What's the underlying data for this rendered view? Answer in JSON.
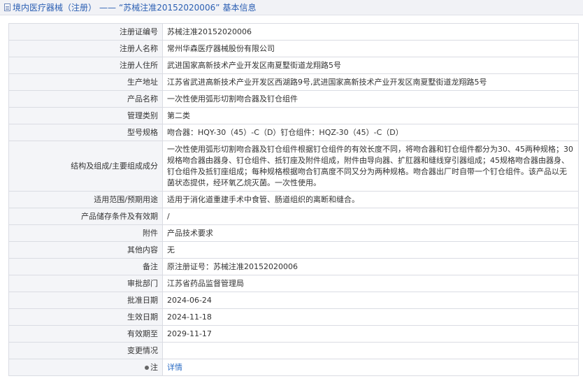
{
  "header": {
    "prefix": "境内医疗器械（注册）",
    "dash": "——",
    "reg_no_quoted": "“苏械注准20152020006”",
    "suffix": "基本信息"
  },
  "rows": [
    {
      "label": "注册证编号",
      "value": "苏械注准20152020006"
    },
    {
      "label": "注册人名称",
      "value": "常州华森医疗器械股份有限公司"
    },
    {
      "label": "注册人住所",
      "value": "武进国家高新技术产业开发区南夏墅街道龙翔路5号"
    },
    {
      "label": "生产地址",
      "value": "江苏省武进高新技术产业开发区西湖路9号,武进国家高新技术产业开发区南夏墅街道龙翔路5号"
    },
    {
      "label": "产品名称",
      "value": "一次性使用弧形切割吻合器及钉仓组件"
    },
    {
      "label": "管理类别",
      "value": "第二类"
    },
    {
      "label": "型号规格",
      "value": "吻合器：HQY-30（45）-C（D）钉仓组件：HQZ-30（45）-C（D）"
    },
    {
      "label": "结构及组成/主要组成成分",
      "value": "一次性使用弧形切割吻合器及钉仓组件根据钉仓组件的有效长度不同，将吻合器和钉仓组件都分为30、45两种规格；30规格吻合器由器身、钉仓组件、抵钉座及附件组成，附件由导向器、扩肛器和缝线穿引器组成；45规格吻合器由器身、钉仓组件及抵钉座组成；每种规格根据吻合钉高度不同又分为两种规格。吻合器出厂时自带一个钉仓组件。该产品以无菌状态提供，经环氧乙烷灭菌。一次性使用。"
    },
    {
      "label": "适用范围/预期用途",
      "value": "适用于消化道重建手术中食管、肠道组织的离断和缝合。"
    },
    {
      "label": "产品储存条件及有效期",
      "value": "/"
    },
    {
      "label": "附件",
      "value": "产品技术要求"
    },
    {
      "label": "其他内容",
      "value": "无"
    },
    {
      "label": "备注",
      "value": "原注册证号：苏械注准20152020006"
    },
    {
      "label": "审批部门",
      "value": "江苏省药品监督管理局"
    },
    {
      "label": "批准日期",
      "value": "2024-06-24"
    },
    {
      "label": "生效日期",
      "value": "2024-11-18"
    },
    {
      "label": "有效期至",
      "value": "2029-11-17"
    },
    {
      "label": "变更情况",
      "value": ""
    }
  ],
  "note": {
    "label": "注",
    "link": "详情"
  }
}
